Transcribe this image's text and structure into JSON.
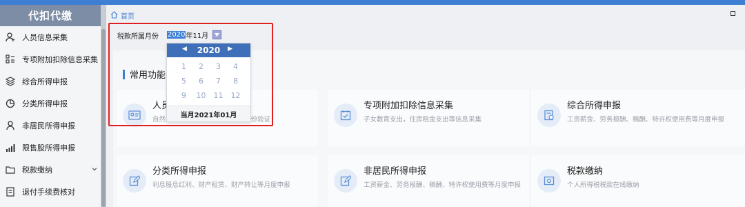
{
  "sidebar": {
    "title": "代扣代缴",
    "items": [
      {
        "label": "人员信息采集",
        "icon": "person-icon"
      },
      {
        "label": "专项附加扣除信息采集",
        "icon": "grid-list-icon"
      },
      {
        "label": "综合所得申报",
        "icon": "layers-icon"
      },
      {
        "label": "分类所得申报",
        "icon": "pie-clock-icon"
      },
      {
        "label": "非居民所得申报",
        "icon": "user-outline-icon"
      },
      {
        "label": "限售股所得申报",
        "icon": "bar-chart-icon"
      },
      {
        "label": "税款缴纳",
        "icon": "folder-icon"
      },
      {
        "label": "退付手续费核对",
        "icon": "document-icon"
      }
    ]
  },
  "breadcrumb": {
    "home": "首页"
  },
  "filter": {
    "label": "税款所属月份",
    "year": "2020",
    "month_suffix": "年11月"
  },
  "picker": {
    "year": "2020",
    "months": [
      "1",
      "2",
      "3",
      "4",
      "5",
      "6",
      "7",
      "8",
      "9",
      "10",
      "11",
      "12"
    ],
    "footer": "当月2021年01月"
  },
  "section": {
    "title": "常用功能"
  },
  "tiles": [
    {
      "title": "人员信息采集",
      "desc": "自然人基础信息采集，公安系统身份验证",
      "icon": "id-card-icon"
    },
    {
      "title": "专项附加扣除信息采集",
      "desc": "子女教育支出，住房租金支出等信息采集",
      "icon": "calendar-doc-icon"
    },
    {
      "title": "综合所得申报",
      "desc": "工资薪金、劳务报酬、稿酬、特许权使用费等月度申报",
      "icon": "report-icon"
    },
    {
      "title": "分类所得申报",
      "desc": "利息股息红利、财产租赁、财产转让等月度申报",
      "icon": "edit-icon"
    },
    {
      "title": "非居民所得申报",
      "desc": "工资薪金、劳务报酬、稿酬、特许权使用费等月度申报",
      "icon": "edit-icon"
    },
    {
      "title": "税款缴纳",
      "desc": "个人所得税税款在线缴纳",
      "icon": "payment-icon"
    }
  ],
  "colors": {
    "accent": "#3f7fd3",
    "highlight": "#e02020",
    "sidebar_header": "#7d8da5"
  }
}
